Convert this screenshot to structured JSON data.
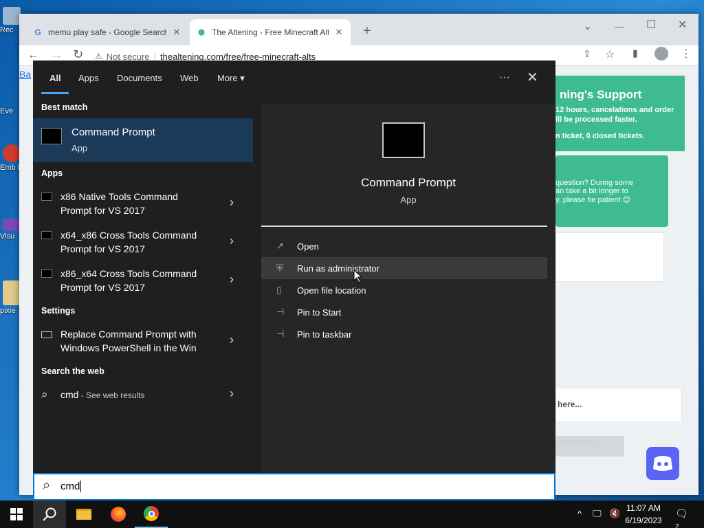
{
  "desktop": {
    "icons": [
      {
        "label": "Rec",
        "color": "#9db7d1"
      },
      {
        "label": "Eve",
        "color": "#2a6bb8"
      },
      {
        "label": "Emb De",
        "color": "#d33b2c"
      },
      {
        "label": "Visu",
        "color": "#7a4bb8"
      },
      {
        "label": "pixie",
        "color": "#e3c98a"
      }
    ]
  },
  "browser": {
    "tabs": [
      {
        "title": "memu play safe - Google Search",
        "favicon": "G",
        "close": "✕"
      },
      {
        "title": "The Altening - Free Minecraft Alts",
        "favicon": "⬢",
        "close": "✕"
      }
    ],
    "new_tab": "+",
    "window_controls": {
      "dropdown": "⌄",
      "minimize": "—",
      "maximize": "☐",
      "close": "✕"
    },
    "nav": {
      "back": "←",
      "forward": "→",
      "reload": "↻"
    },
    "omnibox": {
      "warning": "Not secure",
      "url": "thealtening.com/free/free-minecraft-alts"
    },
    "back_link": "Ba",
    "page": {
      "support_title": "ning's Support",
      "support_line1": "12 hours, cancelations and order",
      "support_line2": "ill be processed faster.",
      "tickets_prefix": "n ticket, ",
      "closed_count": "0",
      "tickets_suffix": " closed tickets.",
      "msg_line1": "question? During some",
      "msg_line2": "an take a bit longer to",
      "msg_line3": "y, please be patient 😊",
      "input_placeholder": "here...",
      "footer_snippet": "month) with a..."
    }
  },
  "start": {
    "tabs": [
      {
        "label": "All",
        "active": true
      },
      {
        "label": "Apps",
        "active": false
      },
      {
        "label": "Documents",
        "active": false
      },
      {
        "label": "Web",
        "active": false
      },
      {
        "label": "More",
        "active": false
      }
    ],
    "more_caret": "▾",
    "dots": "···",
    "close": "✕",
    "sections": {
      "best_match": "Best match",
      "apps": "Apps",
      "settings": "Settings",
      "search_web": "Search the web"
    },
    "best": {
      "title": "Command Prompt",
      "subtitle": "App"
    },
    "apps": [
      {
        "line1": "x86 Native Tools Command",
        "line2": "Prompt for VS 2017"
      },
      {
        "line1": "x64_x86 Cross Tools Command",
        "line2": "Prompt for VS 2017"
      },
      {
        "line1": "x86_x64 Cross Tools Command",
        "line2": "Prompt for VS 2017"
      }
    ],
    "settings": [
      {
        "line1": "Replace Command Prompt with",
        "line2": "Windows PowerShell in the Win"
      }
    ],
    "web": {
      "query": "cmd",
      "suffix": " - See web results"
    },
    "chevron": "›",
    "preview": {
      "title": "Command Prompt",
      "subtitle": "App"
    },
    "actions": [
      {
        "label": "Open",
        "icon": "↗"
      },
      {
        "label": "Run as administrator",
        "icon": "⛨"
      },
      {
        "label": "Open file location",
        "icon": "▯"
      },
      {
        "label": "Pin to Start",
        "icon": "⊣"
      },
      {
        "label": "Pin to taskbar",
        "icon": "⊣"
      }
    ]
  },
  "searchbox": {
    "value": "cmd",
    "icon": "⌕"
  },
  "taskbar": {
    "time": "11:07 AM",
    "date": "6/19/2023",
    "notifications": "2",
    "tray_caret": "^"
  }
}
